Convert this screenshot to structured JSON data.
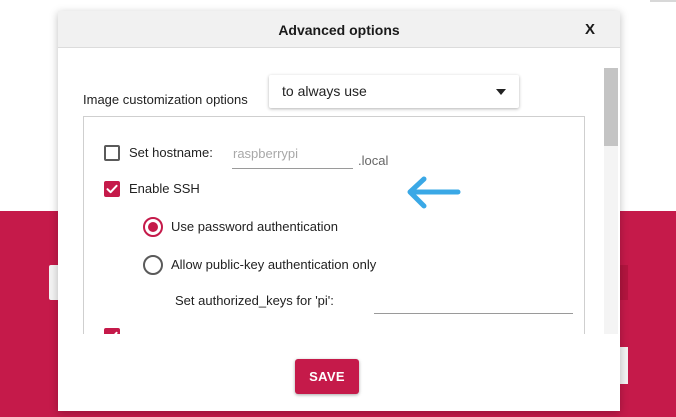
{
  "dialog": {
    "title": "Advanced options",
    "close_label": "X"
  },
  "customization": {
    "label": "Image customization options",
    "selected": "to always use"
  },
  "hostname": {
    "label": "Set hostname:",
    "checked": false,
    "placeholder": "raspberrypi",
    "suffix": ".local"
  },
  "ssh": {
    "label": "Enable SSH",
    "checked": true,
    "options": [
      {
        "label": "Use password authentication",
        "selected": true
      },
      {
        "label": "Allow public-key authentication only",
        "selected": false
      }
    ],
    "authorized_keys_label": "Set authorized_keys for 'pi':",
    "authorized_keys_value": ""
  },
  "next_option": {
    "checked": true
  },
  "footer": {
    "save_label": "SAVE"
  },
  "colors": {
    "accent": "#c51a4a",
    "arrow": "#3aa8e6"
  },
  "icons": {
    "annotation_arrow": "arrow-left-icon",
    "select_caret": "caret-down-icon",
    "checkbox_check": "check-icon"
  }
}
